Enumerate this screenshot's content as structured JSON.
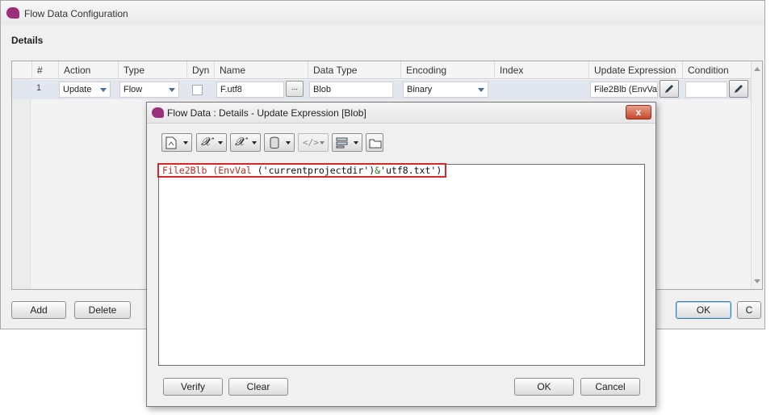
{
  "window": {
    "title": "Flow Data Configuration",
    "section_title": "Details"
  },
  "grid": {
    "columns": [
      "#",
      "Action",
      "Type",
      "Dyn",
      "Name",
      "Data Type",
      "Encoding",
      "Index",
      "Update Expression",
      "Condition"
    ],
    "row": {
      "num": "1",
      "action": "Update",
      "type": "Flow",
      "name": "F.utf8",
      "name_button": "...",
      "data_type": "Blob",
      "encoding": "Binary",
      "update_expression": "File2Blb (EnvVal"
    }
  },
  "buttons": {
    "add": "Add",
    "delete": "Delete",
    "ok": "OK",
    "cancel_partial": "C"
  },
  "dialog": {
    "title": "Flow Data : Details - Update Expression [Blob]",
    "close": "x",
    "expression": {
      "fn": "File2Blb",
      "sp1": " ",
      "fn2": "(EnvVal",
      "sp2": " ",
      "arg": "('currentprojectdir')",
      "op": "&",
      "arg2": "'utf8.txt')"
    },
    "buttons": {
      "verify": "Verify",
      "clear": "Clear",
      "ok": "OK",
      "cancel": "Cancel"
    }
  }
}
